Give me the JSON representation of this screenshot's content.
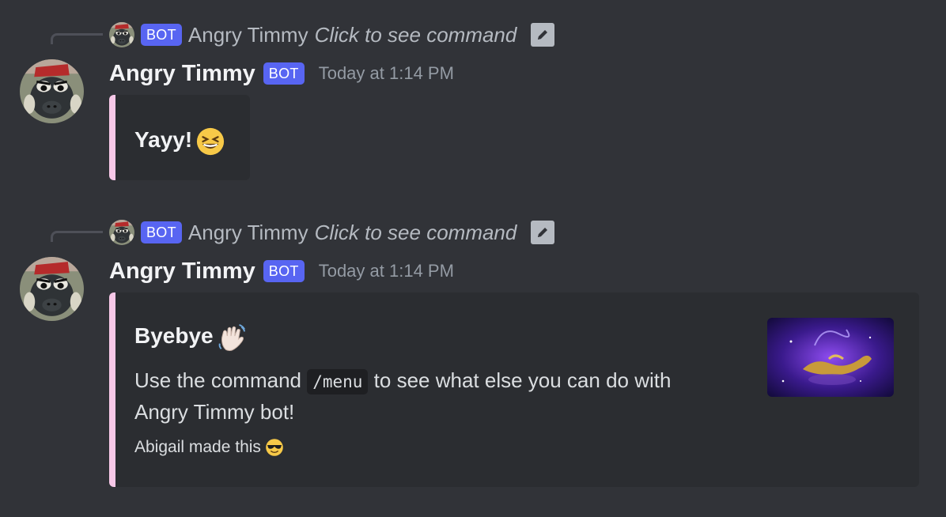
{
  "messages": [
    {
      "reply": {
        "bot_tag": "BOT",
        "name": "Angry Timmy",
        "command": "Click to see command"
      },
      "author": {
        "name": "Angry Timmy",
        "bot_tag": "BOT",
        "timestamp": "Today at 1:14 PM"
      },
      "embed": {
        "title": "Yayy!",
        "title_emoji": "laughing-emoji",
        "accent_color": "#f7c8e8"
      }
    },
    {
      "reply": {
        "bot_tag": "BOT",
        "name": "Angry Timmy",
        "command": "Click to see command"
      },
      "author": {
        "name": "Angry Timmy",
        "bot_tag": "BOT",
        "timestamp": "Today at 1:14 PM"
      },
      "embed": {
        "title": "Byebye",
        "title_emoji": "waving-hand-emoji",
        "description_before": "Use the command",
        "description_code": "/menu",
        "description_after_line1": "to see what else you can do with",
        "description_line2": "Angry Timmy bot!",
        "footer": "Abigail made this",
        "footer_emoji": "sunglasses-emoji",
        "thumbnail": "magic-lamp-image",
        "accent_color": "#f7c8e8"
      }
    }
  ],
  "colors": {
    "background": "#313338",
    "embed_background": "#2b2d31",
    "bot_tag": "#5865f2",
    "timestamp": "#949ba4"
  }
}
